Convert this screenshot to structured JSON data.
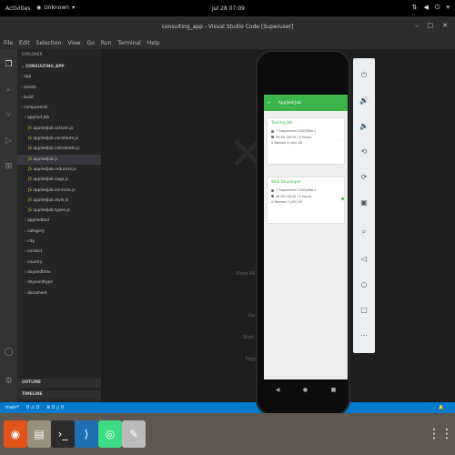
{
  "topbar": {
    "activities": "Activities",
    "app_name": "Unknown",
    "clock": "Jul 28  07:09"
  },
  "window": {
    "title": "consulting_app - Visual Studio Code [Superuser]"
  },
  "menu": [
    "File",
    "Edit",
    "Selection",
    "View",
    "Go",
    "Run",
    "Terminal",
    "Help"
  ],
  "sidebar": {
    "header": "EXPLORER",
    "project": "CONSULTING_APP",
    "items": [
      {
        "label": "app",
        "indent": 1
      },
      {
        "label": "assets",
        "indent": 1
      },
      {
        "label": "build",
        "indent": 1
      },
      {
        "label": "components",
        "indent": 1
      },
      {
        "label": "applied-job",
        "indent": 2
      },
      {
        "label": "appliedjob.actions.js",
        "indent": 3
      },
      {
        "label": "appliedjob.constants.js",
        "indent": 3
      },
      {
        "label": "appliedjob.initialstate.js",
        "indent": 3
      },
      {
        "label": "appliedjob.js",
        "indent": 3
      },
      {
        "label": "appliedjob.reducers.js",
        "indent": 3
      },
      {
        "label": "appliedjob.saga.js",
        "indent": 3
      },
      {
        "label": "appliedjob.services.js",
        "indent": 3
      },
      {
        "label": "appliedjob.style.js",
        "indent": 3
      },
      {
        "label": "appliedjob.types.js",
        "indent": 3
      },
      {
        "label": "appliedtest",
        "indent": 2
      },
      {
        "label": "category",
        "indent": 2
      },
      {
        "label": "city",
        "indent": 2
      },
      {
        "label": "contact",
        "indent": 2
      },
      {
        "label": "country",
        "indent": 2
      },
      {
        "label": "dayandtime",
        "indent": 2
      },
      {
        "label": "daysandtype",
        "indent": 2
      },
      {
        "label": "document",
        "indent": 2
      }
    ],
    "sections": [
      "OUTLINE",
      "TIMELINE"
    ]
  },
  "editor": {
    "hint1": "Show All Commands",
    "hint2": "Go to File",
    "hint3": "Start Debugging",
    "hint4": "Toggle Terminal"
  },
  "status": {
    "branch": "main*",
    "errors": "0 ⚠ 0",
    "extra": "⊗ 0 △ 0"
  },
  "phone": {
    "app_title": "Applied Job",
    "cards": [
      {
        "title": "Testing Job",
        "line1": "7 September 2020(Mon)",
        "line2": "08:00-18:00 , 6 Hours",
        "line3": "0 Review 0 (d5) US"
      },
      {
        "title": "Web Developer",
        "line1": "7 September 2020(Mon)",
        "line2": "08:00-18:00 , 9 hours",
        "line3": "0 Review 0 (d5) US"
      }
    ]
  },
  "emulator_controls": [
    "power-icon",
    "volume-up-icon",
    "volume-down-icon",
    "rotate-left-icon",
    "rotate-right-icon",
    "screenshot-icon",
    "zoom-icon",
    "back-icon",
    "home-icon",
    "overview-icon",
    "more-icon"
  ]
}
